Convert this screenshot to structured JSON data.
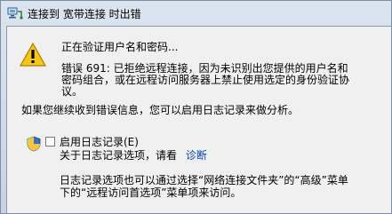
{
  "window": {
    "title": "连接到 宽带连接 时出错"
  },
  "dialog": {
    "status_text": "正在验证用户名和密码...",
    "error_lines": [
      "错误 691: 已拒绝远程连接，因为未识别出您提供的用户名和",
      "密码组合，或在远程访问服务器上禁止使用选定的身份验证协",
      "议。"
    ],
    "retry_text": "如果您继续收到错误信息，您可以启用日志记录来做分析。",
    "enable_log_label": "启用日志记录(E)",
    "log_info_prefix": "关于日志记录选项，请看",
    "diagnose_link": "诊断",
    "footer_lines": [
      "日志记录选项也可以通过选择“网络连接文件夹”的“高级”菜单",
      "下的“远程访问首选项”菜单项来访问。"
    ]
  }
}
